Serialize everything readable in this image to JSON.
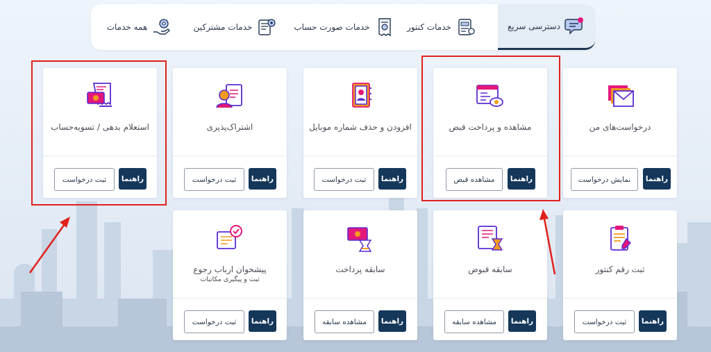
{
  "tabs": [
    {
      "label": "دسترسی سریع",
      "icon": "chat-bubble-icon",
      "active": true
    },
    {
      "label": "خدمات کنتور",
      "icon": "meter-document-icon"
    },
    {
      "label": "خدمات صورت حساب",
      "icon": "receipt-icon"
    },
    {
      "label": "خدمات مشترکین",
      "icon": "subscriber-gear-icon"
    },
    {
      "label": "همه خدمات",
      "icon": "hand-gear-icon"
    }
  ],
  "cards": [
    {
      "title": "درخواست‌های من",
      "icon": "mail-stack-icon",
      "help_label": "راهنما",
      "action_label": "نمایش درخواست"
    },
    {
      "title": "مشاهده و پرداخت قبض",
      "icon": "bill-view-icon",
      "help_label": "راهنما",
      "action_label": "مشاهده قبض"
    },
    {
      "title": "افزودن و حذف شماره موبایل",
      "icon": "phone-book-icon",
      "help_label": "راهنما",
      "action_label": "ثبت درخواست"
    },
    {
      "title": "اشتراک‌پذیری",
      "icon": "subscription-user-icon",
      "help_label": "راهنما",
      "action_label": "ثبت درخواست"
    },
    {
      "title": "استعلام بدهی / تسویه‌حساب",
      "icon": "debt-inquiry-icon",
      "help_label": "راهنما",
      "action_label": "ثبت درخواست"
    },
    {
      "title": "ثبت رقم کنتور",
      "icon": "clipboard-pen-icon",
      "help_label": "راهنما",
      "action_label": "ثبت درخواست"
    },
    {
      "title": "سابقه قبوض",
      "icon": "bill-history-icon",
      "help_label": "راهنما",
      "action_label": "مشاهده سابقه"
    },
    {
      "title": "سابقه پرداخت",
      "icon": "payment-history-icon",
      "help_label": "راهنما",
      "action_label": "مشاهده سابقه"
    },
    {
      "title": "پیشخوان ارباب رجوع",
      "subtitle": "ثبت و پیگیری مکاتبات",
      "icon": "service-desk-check-icon",
      "help_label": "راهنما",
      "action_label": "ثبت درخواست"
    }
  ],
  "colors": {
    "primary": "#15375a",
    "highlight": "#e0201c",
    "icon_pink": "#e4177a",
    "icon_purple": "#5b2bd1",
    "icon_orange": "#f29a1f"
  }
}
